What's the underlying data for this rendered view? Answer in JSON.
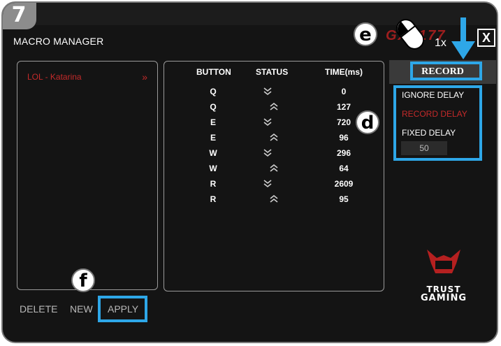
{
  "step_number": "7",
  "app": {
    "title": "MACRO MANAGER",
    "close_label": "X",
    "logo_text": "GXT177"
  },
  "annotations": {
    "e": "e",
    "d": "d",
    "f": "f",
    "count": "1x"
  },
  "profiles": [
    {
      "label": "LOL - Katarina",
      "chevron": "»"
    }
  ],
  "table": {
    "headers": [
      "BUTTON",
      "STATUS",
      "TIME(ms)"
    ],
    "rows": [
      {
        "button": "Q",
        "status": "down",
        "time": "0"
      },
      {
        "button": "Q",
        "status": "up",
        "time": "127"
      },
      {
        "button": "E",
        "status": "down",
        "time": "720"
      },
      {
        "button": "E",
        "status": "up",
        "time": "96"
      },
      {
        "button": "W",
        "status": "down",
        "time": "296"
      },
      {
        "button": "W",
        "status": "up",
        "time": "64"
      },
      {
        "button": "R",
        "status": "down",
        "time": "2609"
      },
      {
        "button": "R",
        "status": "up",
        "time": "95"
      }
    ]
  },
  "record": {
    "label": "RECORD"
  },
  "delay_options": {
    "ignore": "IGNORE DELAY",
    "record": "RECORD DELAY",
    "fixed": "FIXED DELAY",
    "fixed_value": "50",
    "selected": "record"
  },
  "bottom_buttons": {
    "delete": "DELETE",
    "new": "NEW",
    "apply": "APPLY"
  },
  "brand": {
    "mark": "GXT",
    "line1": "TRUST",
    "line2": "GAMING"
  },
  "colors": {
    "accent_red": "#c42a2a",
    "highlight_blue": "#2ea7e8",
    "background": "#141414"
  }
}
